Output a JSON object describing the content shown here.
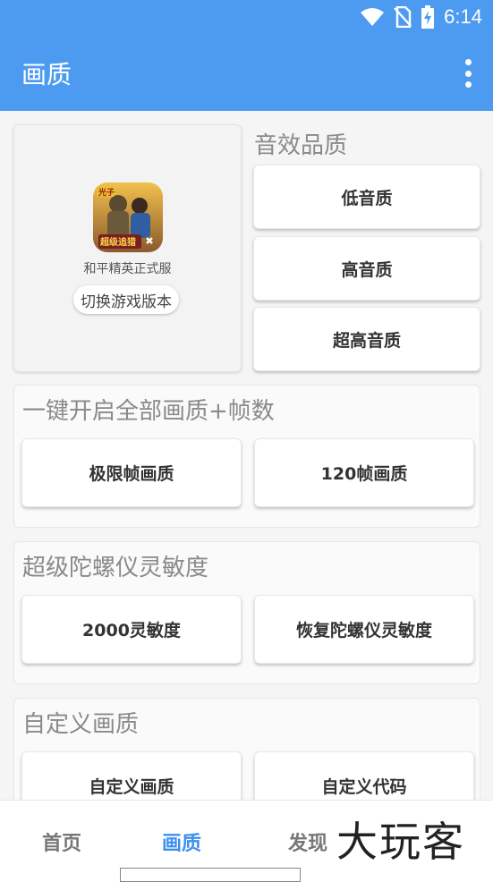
{
  "status": {
    "time": "6:14",
    "icons": [
      "wifi-icon",
      "no-sim-icon",
      "battery-charging-icon"
    ]
  },
  "app_bar": {
    "title": "画质",
    "menu_icon": "more-vert-icon"
  },
  "game_card": {
    "name": "和平精英正式服",
    "switch_label": "切换游戏版本",
    "icon_caption": "超级追猎",
    "icon_badge": "光子"
  },
  "audio": {
    "title": "音效品质",
    "buttons": [
      "低音质",
      "高音质",
      "超高音质"
    ]
  },
  "oneclick": {
    "title": "一键开启全部画质+帧数",
    "buttons": [
      "极限帧画质",
      "120帧画质"
    ]
  },
  "gyro": {
    "title": "超级陀螺仪灵敏度",
    "buttons": [
      "2000灵敏度",
      "恢复陀螺仪灵敏度"
    ]
  },
  "custom": {
    "title": "自定义画质",
    "buttons": [
      "自定义画质",
      "自定义代码"
    ]
  },
  "bottom_nav": {
    "items": [
      "首页",
      "画质",
      "发现"
    ],
    "active": "画质"
  },
  "watermark": {
    "text": "大玩客"
  },
  "colors": {
    "primary": "#4d9bf1",
    "active_tab": "#3d8fee"
  }
}
